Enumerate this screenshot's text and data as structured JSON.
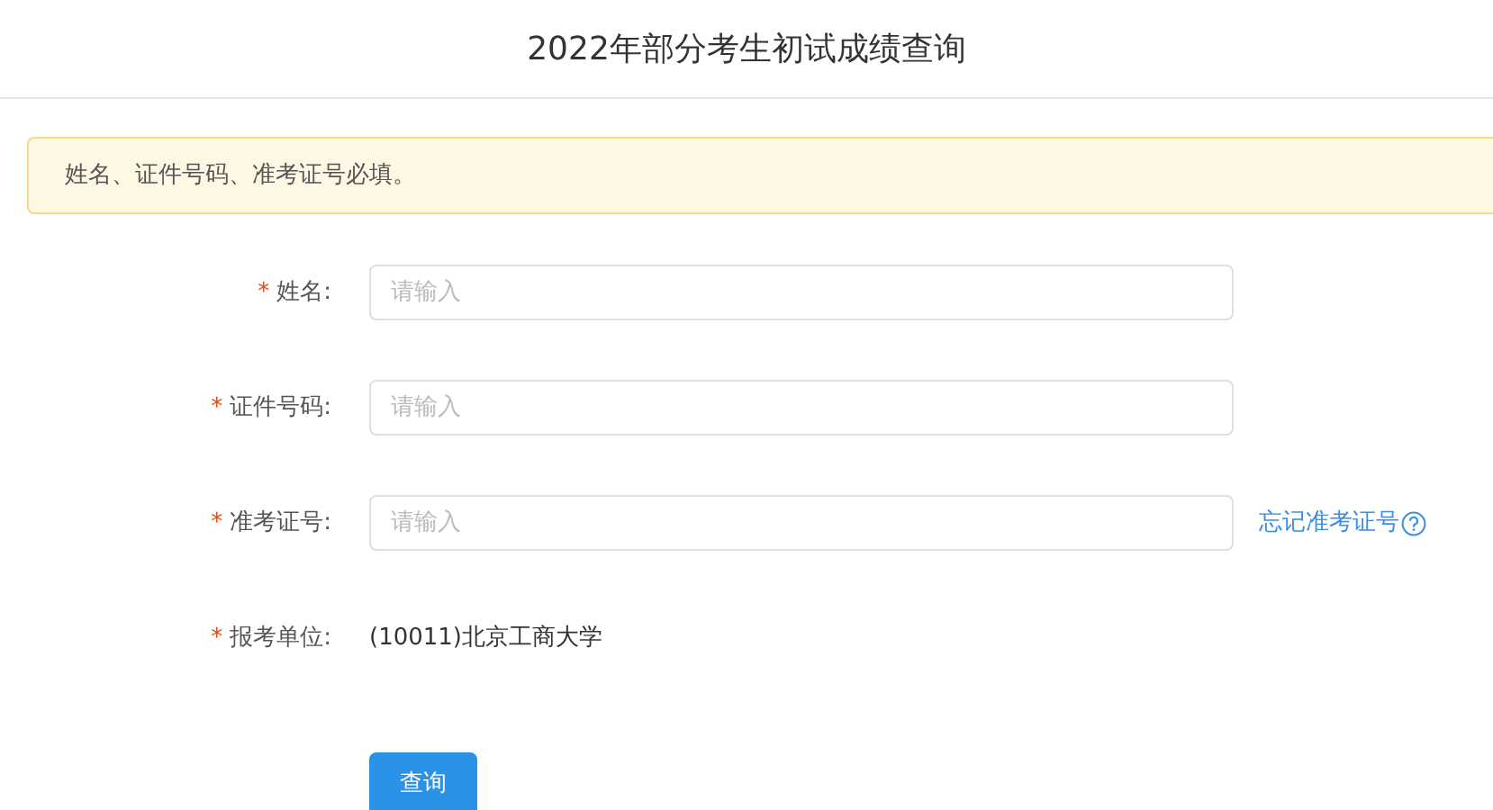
{
  "header": {
    "title": "2022年部分考生初试成绩查询"
  },
  "notice": {
    "text": "姓名、证件号码、准考证号必填。"
  },
  "form": {
    "fields": [
      {
        "kind": "input",
        "marker": "*",
        "label": "姓名:",
        "placeholder": "请输入"
      },
      {
        "kind": "input",
        "marker": "*",
        "label": "证件号码:",
        "placeholder": "请输入"
      },
      {
        "kind": "input",
        "marker": "*",
        "label": "准考证号:",
        "placeholder": "请输入",
        "help_link": "忘记准考证号"
      },
      {
        "kind": "static",
        "marker": "*",
        "label": "报考单位:",
        "value": "(10011)北京工商大学"
      }
    ],
    "submit": "查询"
  }
}
